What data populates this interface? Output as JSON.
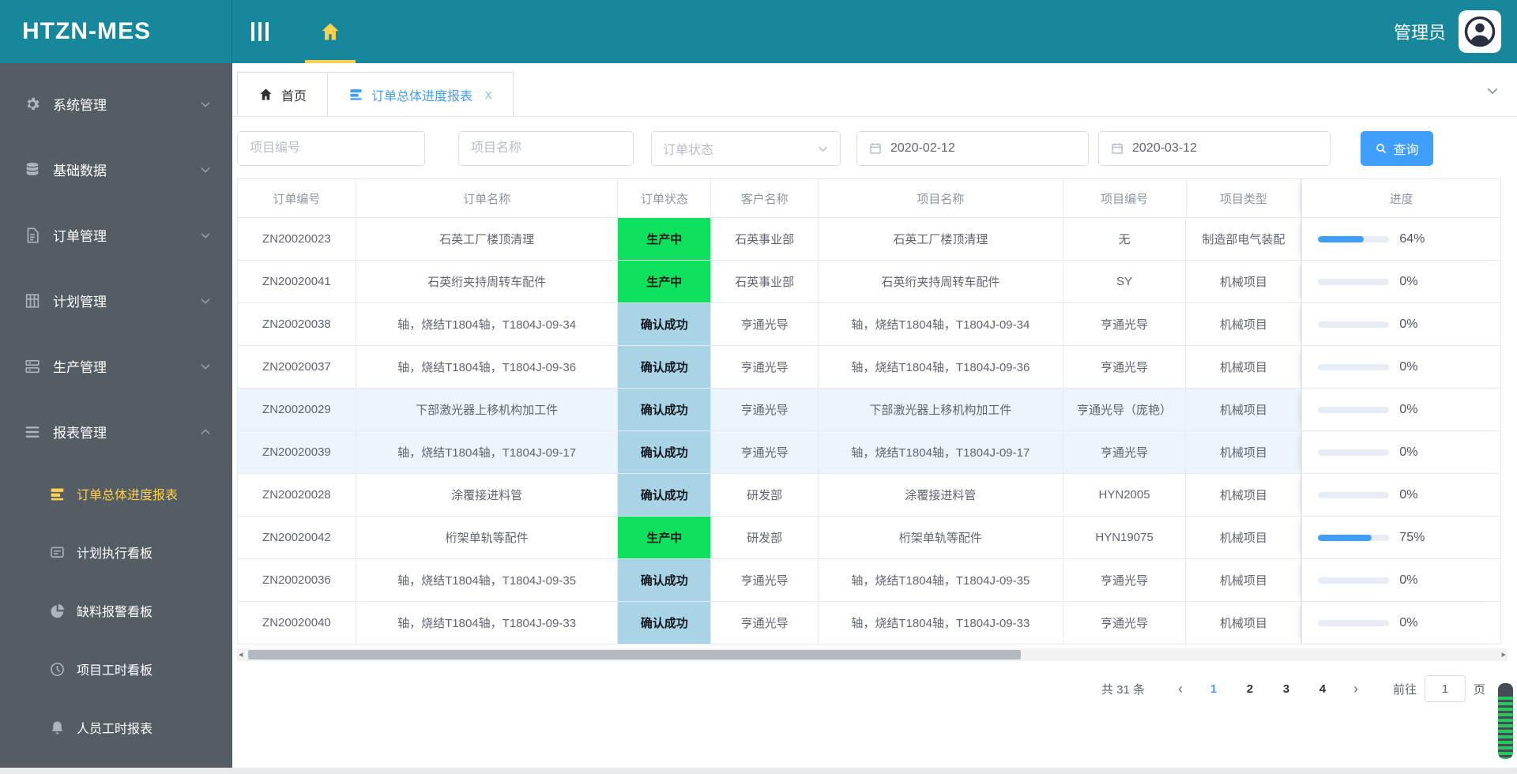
{
  "app": {
    "title": "HTZN-MES",
    "user": "管理员"
  },
  "colors": {
    "header_teal": "#17879b",
    "sidebar_dark": "#545c64",
    "active_yellow": "#ffd04b",
    "accent_blue": "#409eff",
    "status_green": "#0ee15e",
    "status_blue": "#a9d4e6"
  },
  "sidebar": {
    "items": [
      {
        "key": "system",
        "label": "系统管理",
        "icon": "gear-icon"
      },
      {
        "key": "basic-data",
        "label": "基础数据",
        "icon": "database-icon"
      },
      {
        "key": "orders",
        "label": "订单管理",
        "icon": "document-icon"
      },
      {
        "key": "planning",
        "label": "计划管理",
        "icon": "grid-icon"
      },
      {
        "key": "production",
        "label": "生产管理",
        "icon": "server-icon"
      },
      {
        "key": "reports",
        "label": "报表管理",
        "icon": "menu-icon",
        "expanded": true
      }
    ],
    "subitems": [
      {
        "key": "order-progress-report",
        "label": "订单总体进度报表",
        "icon": "report-icon",
        "active": true
      },
      {
        "key": "plan-execution-board",
        "label": "计划执行看板",
        "icon": "board-icon"
      },
      {
        "key": "shortage-alarm-board",
        "label": "缺料报警看板",
        "icon": "pie-icon"
      },
      {
        "key": "project-hours-board",
        "label": "项目工时看板",
        "icon": "clock-icon"
      },
      {
        "key": "staff-hours-report",
        "label": "人员工时报表",
        "icon": "bell-icon"
      }
    ]
  },
  "tabs": [
    {
      "key": "home",
      "label": "首页",
      "icon": "home-icon",
      "closable": false,
      "active": false
    },
    {
      "key": "report",
      "label": "订单总体进度报表",
      "icon": "report-icon",
      "closable": true,
      "active": true,
      "close_glyph": "x"
    }
  ],
  "filters": {
    "project_no_placeholder": "项目编号",
    "project_name_placeholder": "项目名称",
    "order_status_placeholder": "订单状态",
    "date_from": "2020-02-12",
    "date_to": "2020-03-12",
    "search_label": "查询"
  },
  "table": {
    "columns": [
      "订单编号",
      "订单名称",
      "订单状态",
      "客户名称",
      "项目名称",
      "项目编号",
      "项目类型",
      "进度"
    ],
    "rows": [
      {
        "order_no": "ZN20020023",
        "order_name": "石英工厂楼顶清理",
        "status": "生产中",
        "status_type": "green",
        "customer": "石英事业部",
        "project_name": "石英工厂楼顶清理",
        "project_no": "无",
        "project_type": "制造部电气装配",
        "progress": 64,
        "highlight": false
      },
      {
        "order_no": "ZN20020041",
        "order_name": "石英绗夹持周转车配件",
        "status": "生产中",
        "status_type": "green",
        "customer": "石英事业部",
        "project_name": "石英绗夹持周转车配件",
        "project_no": "SY",
        "project_type": "机械项目",
        "progress": 0,
        "highlight": false
      },
      {
        "order_no": "ZN20020038",
        "order_name": "轴，烧结T1804轴，T1804J-09-34",
        "status": "确认成功",
        "status_type": "blue",
        "customer": "亨通光导",
        "project_name": "轴，烧结T1804轴，T1804J-09-34",
        "project_no": "亨通光导",
        "project_type": "机械项目",
        "progress": 0,
        "highlight": false
      },
      {
        "order_no": "ZN20020037",
        "order_name": "轴，烧结T1804轴，T1804J-09-36",
        "status": "确认成功",
        "status_type": "blue",
        "customer": "亨通光导",
        "project_name": "轴，烧结T1804轴，T1804J-09-36",
        "project_no": "亨通光导",
        "project_type": "机械项目",
        "progress": 0,
        "highlight": false
      },
      {
        "order_no": "ZN20020029",
        "order_name": "下部激光器上移机构加工件",
        "status": "确认成功",
        "status_type": "blue",
        "customer": "亨通光导",
        "project_name": "下部激光器上移机构加工件",
        "project_no": "亨通光导（庞艳）",
        "project_type": "机械项目",
        "progress": 0,
        "highlight": true
      },
      {
        "order_no": "ZN20020039",
        "order_name": "轴，烧结T1804轴，T1804J-09-17",
        "status": "确认成功",
        "status_type": "blue",
        "customer": "亨通光导",
        "project_name": "轴，烧结T1804轴，T1804J-09-17",
        "project_no": "亨通光导",
        "project_type": "机械项目",
        "progress": 0,
        "highlight": true
      },
      {
        "order_no": "ZN20020028",
        "order_name": "涂覆接进料管",
        "status": "确认成功",
        "status_type": "blue",
        "customer": "研发部",
        "project_name": "涂覆接进料管",
        "project_no": "HYN2005",
        "project_type": "机械项目",
        "progress": 0,
        "highlight": false
      },
      {
        "order_no": "ZN20020042",
        "order_name": "桁架单轨等配件",
        "status": "生产中",
        "status_type": "green",
        "customer": "研发部",
        "project_name": "桁架单轨等配件",
        "project_no": "HYN19075",
        "project_type": "机械项目",
        "progress": 75,
        "highlight": false
      },
      {
        "order_no": "ZN20020036",
        "order_name": "轴，烧结T1804轴，T1804J-09-35",
        "status": "确认成功",
        "status_type": "blue",
        "customer": "亨通光导",
        "project_name": "轴，烧结T1804轴，T1804J-09-35",
        "project_no": "亨通光导",
        "project_type": "机械项目",
        "progress": 0,
        "highlight": false
      },
      {
        "order_no": "ZN20020040",
        "order_name": "轴，烧结T1804轴，T1804J-09-33",
        "status": "确认成功",
        "status_type": "blue",
        "customer": "亨通光导",
        "project_name": "轴，烧结T1804轴，T1804J-09-33",
        "project_no": "亨通光导",
        "project_type": "机械项目",
        "progress": 0,
        "highlight": false
      }
    ]
  },
  "pagination": {
    "total_label": "共 31 条",
    "prev_glyph": "‹",
    "next_glyph": "›",
    "pages": [
      "1",
      "2",
      "3",
      "4"
    ],
    "active_page": "1",
    "goto_label": "前往",
    "goto_value": "1",
    "page_label": "页"
  }
}
